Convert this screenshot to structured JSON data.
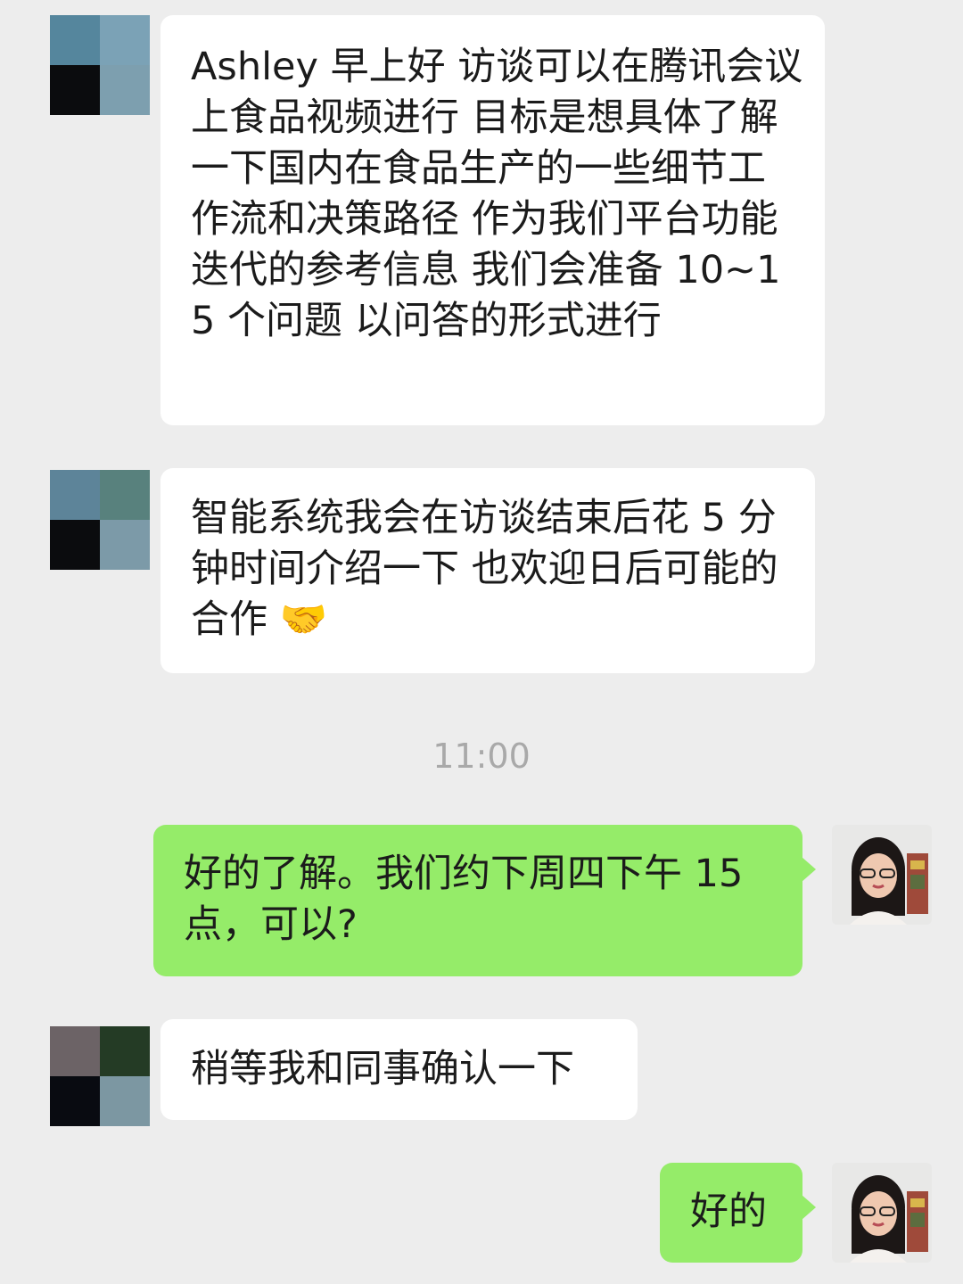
{
  "messages": [
    {
      "sender": "other",
      "text": "Ashley 早上好 访谈可以在腾讯会议上食品视频进行 目标是想具体了解一下国内在食品生产的一些细节工作流和决策路径 作为我们平台功能迭代的参考信息 我们会准备 10~15 个问题 以问答的形式进行"
    },
    {
      "sender": "other",
      "text": "智能系统我会在访谈结束后花 5 分钟时间介绍一下 也欢迎日后可能的合作 🤝"
    },
    {
      "sender": "me",
      "text": "好的了解。我们约下周四下午 15 点，可以?"
    },
    {
      "sender": "other",
      "text": "稍等我和同事确认一下"
    },
    {
      "sender": "me",
      "text": "好的"
    }
  ],
  "timestamp": "11:00",
  "avatars": {
    "other_1_colors": [
      "#55869d",
      "#7ba2b6",
      "#0b0c0e",
      "#7d9faf"
    ],
    "other_2_colors": [
      "#5d8499",
      "#58817d",
      "#0b0c0e",
      "#7c9aa8"
    ],
    "other_3_colors": [
      "#6c6366",
      "#243b25",
      "#090b11",
      "#7c97a2"
    ]
  },
  "colors": {
    "background": "#ededed",
    "incoming_bubble": "#ffffff",
    "outgoing_bubble": "#95ec69",
    "timestamp_text": "#a9a9a9"
  }
}
